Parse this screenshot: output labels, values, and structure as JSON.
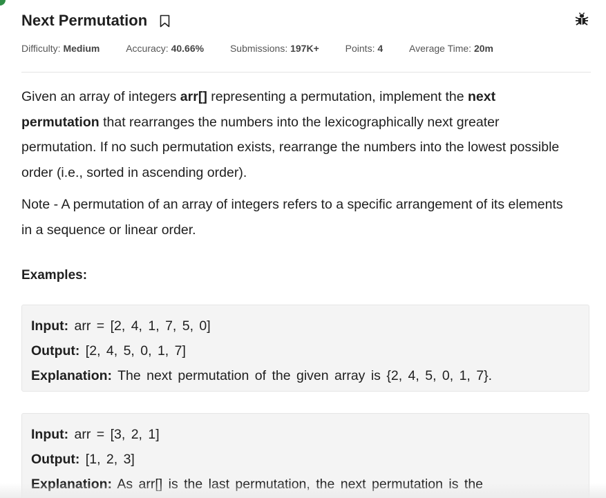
{
  "problem": {
    "title": "Next Permutation",
    "bookmark_icon": "bookmark-icon",
    "report_icon": "bug-icon"
  },
  "meta": {
    "difficulty_label": "Difficulty:",
    "difficulty_value": "Medium",
    "accuracy_label": "Accuracy:",
    "accuracy_value": "40.66%",
    "submissions_label": "Submissions:",
    "submissions_value": "197K+",
    "points_label": "Points:",
    "points_value": "4",
    "avgtime_label": "Average Time:",
    "avgtime_value": "20m"
  },
  "description": {
    "p1_a": "Given an array of integers ",
    "p1_b": "arr[]",
    "p1_c": " representing a permutation, implement the ",
    "p1_d": "next permutation",
    "p1_e": " that rearranges the numbers into the lexicographically next greater permutation. If no such permutation exists, rearrange the numbers into the lowest possible order (i.e., sorted in ascending order).",
    "note": "Note - A permutation of an array of integers refers to a specific arrangement of its elements in a sequence or linear order."
  },
  "examples": {
    "heading": "Examples:",
    "items": [
      {
        "input_label": "Input:",
        "input_value": " arr = [2, 4, 1, 7, 5, 0]",
        "output_label": "Output:",
        "output_value": " [2, 4, 5, 0, 1, 7]",
        "explanation_label": "Explanation:",
        "explanation_value": " The next permutation of the given array is {2, 4, 5, 0, 1, 7}."
      },
      {
        "input_label": "Input:",
        "input_value": " arr = [3, 2, 1]",
        "output_label": "Output:",
        "output_value": " [1, 2, 3]",
        "explanation_label": "Explanation:",
        "explanation_value": " As arr[] is the last permutation, the next permutation is the"
      }
    ]
  }
}
